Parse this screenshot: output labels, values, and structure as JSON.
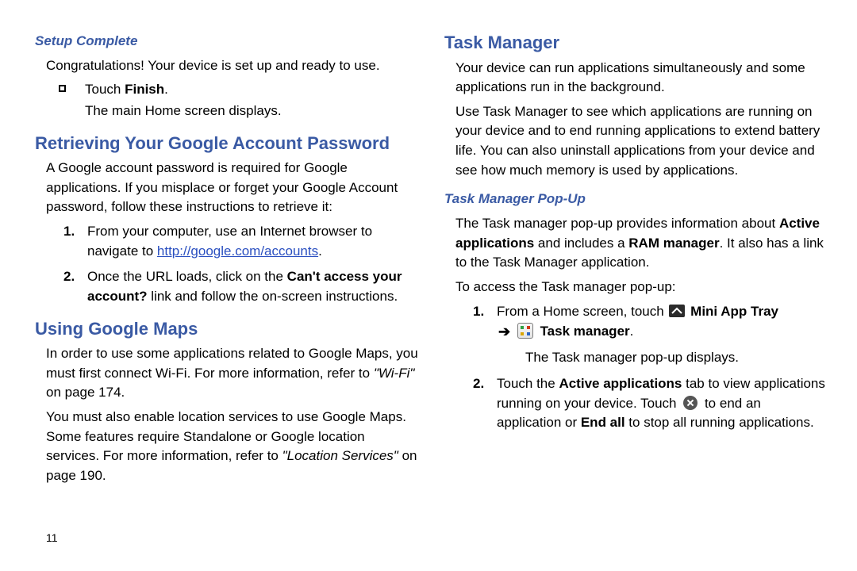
{
  "page_number": "11",
  "left": {
    "setup_complete": {
      "heading": "Setup Complete",
      "congrats": "Congratulations! Your device is set up and ready to use.",
      "touch_prefix": "Touch ",
      "touch_bold": "Finish",
      "touch_suffix": ".",
      "sub": "The main Home screen displays."
    },
    "retrieve": {
      "heading": "Retrieving Your Google Account Password",
      "intro": "A Google account password is required for Google applications. If you misplace or forget your Google Account password, follow these instructions to retrieve it:",
      "step1_num": "1.",
      "step1_prefix": "From your computer, use an Internet browser to navigate to ",
      "step1_link": "http://google.com/accounts",
      "step1_suffix": ".",
      "step2_num": "2.",
      "step2_prefix": "Once the URL loads, click on the ",
      "step2_bold": "Can't access your account?",
      "step2_suffix": " link and follow the on-screen instructions."
    },
    "maps": {
      "heading": "Using Google Maps",
      "p1_prefix": "In order to use some applications related to Google Maps, you must first connect Wi-Fi. For more information, refer to ",
      "p1_italic": "\"Wi-Fi\"",
      "p1_suffix": " on page 174.",
      "p2_prefix": "You must also enable location services to use Google Maps. Some features require Standalone or Google location services. For more information, refer to ",
      "p2_italic": "\"Location Services\"",
      "p2_suffix": " on page 190."
    }
  },
  "right": {
    "tm": {
      "heading": "Task Manager",
      "p1": "Your device can run applications simultaneously and some applications run in the background.",
      "p2": "Use Task Manager to see which applications are running on your device and to end running applications to extend battery life. You can also uninstall applications from your device and see how much memory is used by applications."
    },
    "popup": {
      "heading": "Task Manager Pop-Up",
      "intro_prefix": "The Task manager pop-up provides information about ",
      "intro_b1": "Active applications",
      "intro_mid": " and includes a ",
      "intro_b2": "RAM manager",
      "intro_suffix": ". It also has a link to the Task Manager application.",
      "access": "To access the Task manager pop-up:",
      "step1_num": "1.",
      "step1_prefix": "From a Home screen, touch ",
      "step1_b1": "Mini App Tray",
      "step1_b2": "Task manager",
      "step1_suffix": ".",
      "step1_sub": "The Task manager pop-up displays.",
      "step2_num": "2.",
      "step2_prefix": "Touch the ",
      "step2_b1": "Active applications",
      "step2_mid1": " tab to view applications running on your device. Touch ",
      "step2_mid2": " to end an application or ",
      "step2_b2": "End all",
      "step2_suffix": " to stop all running applications."
    }
  }
}
